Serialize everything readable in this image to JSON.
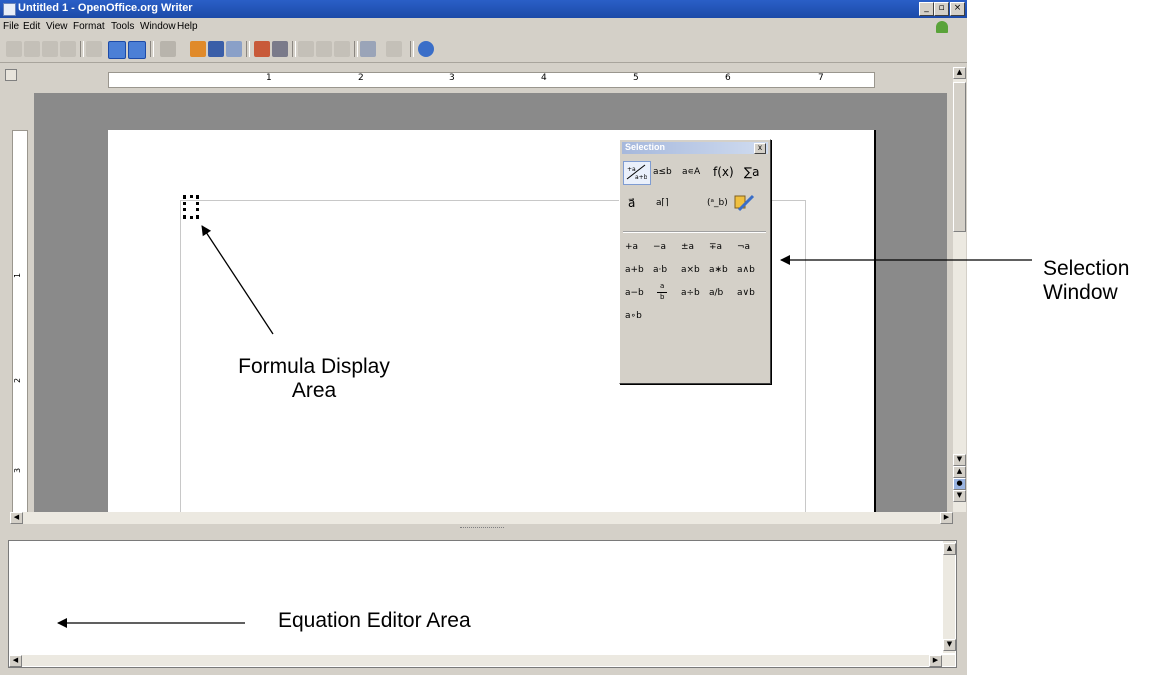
{
  "window": {
    "title": "Untitled 1 - OpenOffice.org Writer",
    "controls": [
      "_",
      "▫",
      "×"
    ]
  },
  "menu": {
    "items": [
      {
        "label": "File"
      },
      {
        "label": "Edit"
      },
      {
        "label": "View"
      },
      {
        "label": "Format"
      },
      {
        "label": "Tools"
      },
      {
        "label": "Window"
      },
      {
        "label": "Help"
      }
    ]
  },
  "ruler": {
    "marks": [
      "1",
      "2",
      "3",
      "4",
      "5",
      "6",
      "7"
    ]
  },
  "vruler": {
    "marks": [
      "1",
      "2",
      "3"
    ]
  },
  "selection_window": {
    "title": "Selection",
    "close": "x",
    "categories": [
      "a≤b",
      "a∊A",
      "f(x)",
      "∑a",
      "a⃗",
      "a⌈⌉",
      "(ᵃ_b)"
    ],
    "symbols": [
      [
        "+a",
        "−a",
        "±a",
        "∓a",
        "¬a"
      ],
      [
        "a+b",
        "a·b",
        "a×b",
        "a∗b",
        "a∧b"
      ],
      [
        "a−b",
        "a/b frac",
        "a÷b",
        "a/b",
        "a∨b"
      ],
      [
        "a∘b"
      ]
    ],
    "fraction_top": "a",
    "fraction_bottom": "b"
  },
  "callouts": {
    "selection_window": "Selection\nWindow",
    "formula_display": "Formula Display\nArea",
    "equation_editor": "Equation Editor Area"
  }
}
